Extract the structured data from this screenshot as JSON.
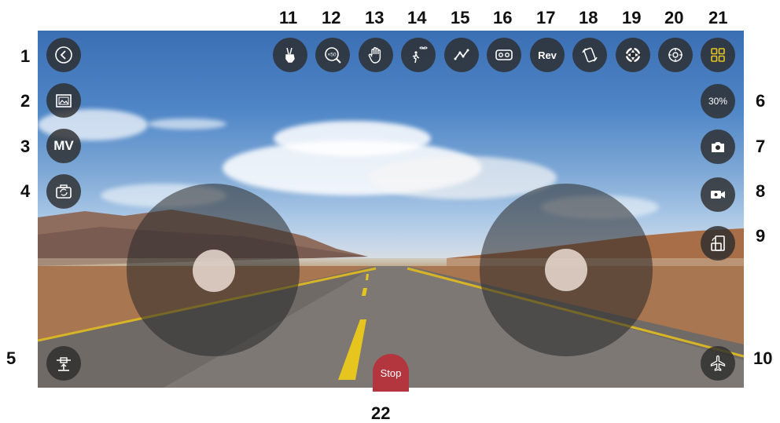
{
  "callouts": {
    "n1": "1",
    "n2": "2",
    "n3": "3",
    "n4": "4",
    "n5": "5",
    "n6": "6",
    "n7": "7",
    "n8": "8",
    "n9": "9",
    "n10": "10",
    "n11": "11",
    "n12": "12",
    "n13": "13",
    "n14": "14",
    "n15": "15",
    "n16": "16",
    "n17": "17",
    "n18": "18",
    "n19": "19",
    "n20": "20",
    "n21": "21",
    "n22": "22"
  },
  "left_column": {
    "back": {
      "icon": "back-arrow-icon"
    },
    "gallery": {
      "icon": "gallery-icon"
    },
    "mv_label": "MV",
    "camera_switch": {
      "icon": "camera-switch-icon"
    },
    "takeoff_land": {
      "icon": "takeoff-icon"
    }
  },
  "top_bar": {
    "gesture": {
      "icon": "peace-gesture-icon"
    },
    "zoom": {
      "icon": "zoom-icon",
      "label": "×50"
    },
    "palm": {
      "icon": "palm-icon"
    },
    "follow": {
      "icon": "follow-me-icon"
    },
    "trajectory": {
      "icon": "trajectory-icon"
    },
    "vr": {
      "icon": "vr-icon"
    },
    "rev_label": "Rev",
    "gravity": {
      "icon": "gravity-sensor-icon"
    },
    "calibrate": {
      "icon": "calibrate-icon"
    },
    "headless": {
      "icon": "headless-mode-icon"
    },
    "menu": {
      "icon": "menu-grid-icon",
      "accent": "#e6c520"
    }
  },
  "right_column": {
    "speed_label": "30%",
    "photo": {
      "icon": "camera-icon"
    },
    "video": {
      "icon": "video-icon"
    },
    "rotate": {
      "icon": "rotate-screen-icon"
    },
    "flight": {
      "icon": "airplane-icon"
    }
  },
  "stop_label": "Stop"
}
